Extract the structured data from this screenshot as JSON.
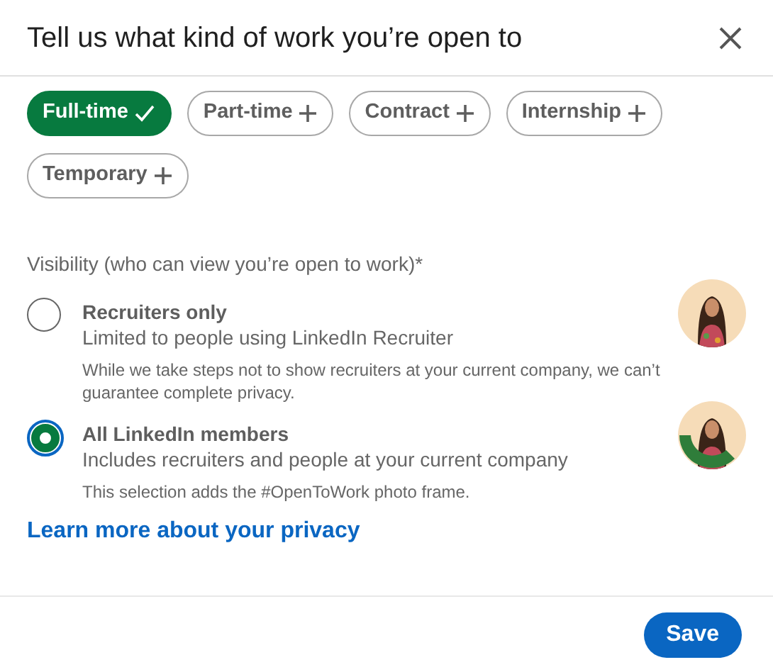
{
  "dialog": {
    "title": "Tell us what kind of work you’re open to"
  },
  "job_types": [
    {
      "label": "Full-time",
      "selected": true
    },
    {
      "label": "Part-time",
      "selected": false
    },
    {
      "label": "Contract",
      "selected": false
    },
    {
      "label": "Internship",
      "selected": false
    },
    {
      "label": "Temporary",
      "selected": false
    }
  ],
  "visibility": {
    "label": "Visibility (who can view you’re open to work)*",
    "options": [
      {
        "title": "Recruiters only",
        "subtitle": "Limited to people using LinkedIn Recruiter",
        "note": "While we take steps not to show recruiters at your current company, we can’t guarantee complete privacy.",
        "selected": false,
        "avatar": {
          "kind": "picture",
          "frame": false
        }
      },
      {
        "title": "All LinkedIn members",
        "subtitle": "Includes recruiters and people at your current company",
        "note": "This selection adds the #OpenToWork photo frame.",
        "selected": true,
        "avatar": {
          "kind": "picture",
          "frame": true
        }
      }
    ]
  },
  "privacy_link": "Learn more about your privacy",
  "buttons": [
    "Save"
  ]
}
